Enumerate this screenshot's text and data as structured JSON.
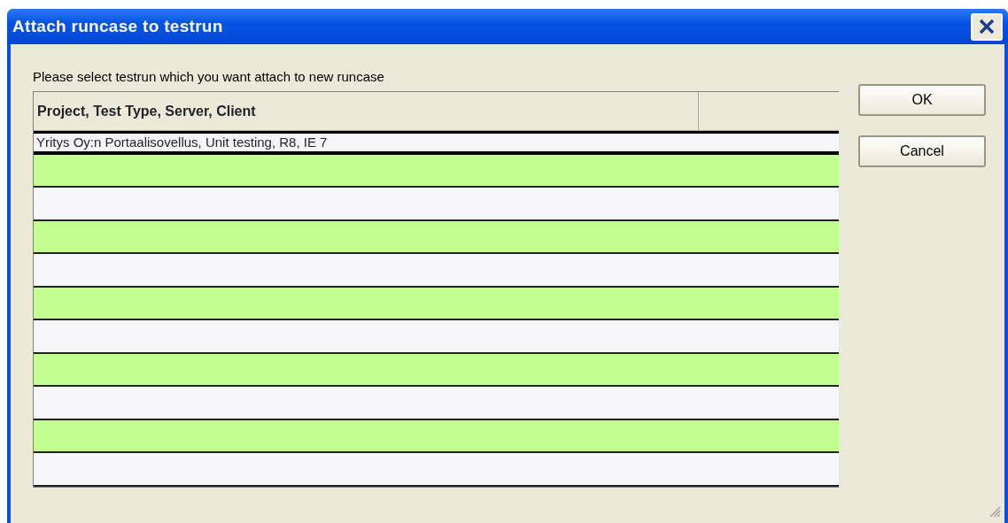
{
  "window": {
    "title": "Attach runcase to testrun"
  },
  "instruction": "Please select testrun which you want attach to new runcase",
  "table": {
    "columns": [
      "Project, Test Type, Server, Client"
    ],
    "rows": [
      {
        "cells": [
          "Yritys Oy:n Portaalisovellus, Unit testing, R8, IE 7"
        ],
        "selected": true
      },
      {
        "selected": false
      },
      {
        "selected": false
      },
      {
        "selected": false
      },
      {
        "selected": false
      },
      {
        "selected": false
      },
      {
        "selected": false
      },
      {
        "selected": false
      },
      {
        "selected": false
      },
      {
        "selected": false
      },
      {
        "selected": false
      }
    ]
  },
  "buttons": [
    "OK",
    "Cancel"
  ]
}
